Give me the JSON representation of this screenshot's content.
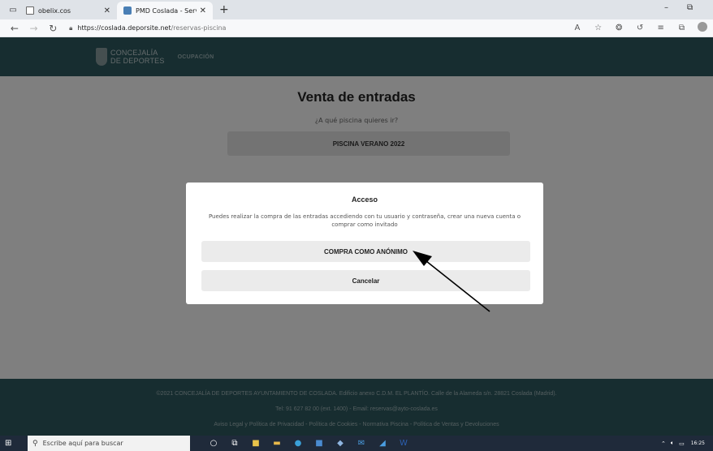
{
  "browser": {
    "tabs": [
      {
        "label": "obelix.cos",
        "active": false
      },
      {
        "label": "PMD Coslada - Servicios OnLine",
        "active": true
      }
    ],
    "address": {
      "host": "https://coslada.deporsite.net",
      "path": "/reservas-piscina"
    }
  },
  "site": {
    "logo_line1": "CONCEJALÍA",
    "logo_line2": "DE DEPORTES",
    "nav_item": "OCUPACIÓN",
    "title": "Venta de entradas",
    "subtitle": "¿A qué piscina quieres ir?",
    "pool_option": "PISCINA VERANO 2022"
  },
  "modal": {
    "title": "Acceso",
    "text": "Puedes realizar la compra de las entradas accediendo con tu usuario y contraseña, crear una nueva cuenta o comprar como invitado",
    "anon_button": "COMPRA COMO ANÓNIMO",
    "cancel_button": "Cancelar"
  },
  "footer": {
    "line1": "©2021 CONCEJALÍA DE DEPORTES AYUNTAMIENTO DE COSLADA. Edificio anexo C.D.M. EL PLANTÍO. Calle de la Alameda s/n. 28821 Coslada (Madrid).",
    "line2": "Tel: 91 627 82 00 (ext. 1400) - Email: reservas@ayto-coslada.es",
    "line3": "Aviso Legal y Política de Privacidad - Política de Cookies - Normativa Piscina - Política de Ventas y Devoluciones"
  },
  "taskbar": {
    "search_placeholder": "Escribe aquí para buscar",
    "time": "16:25"
  },
  "colors": {
    "header": "#2f5a60",
    "overlay": "rgba(0,0,0,0.5)"
  }
}
